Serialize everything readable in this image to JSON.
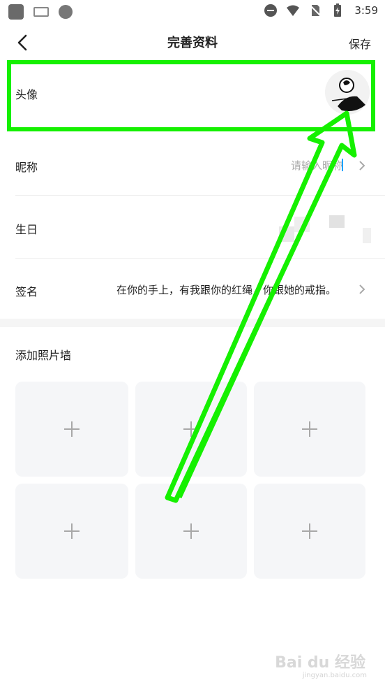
{
  "status_bar": {
    "time": "3:59",
    "left_icons": [
      "app-square-icon",
      "keyboard-icon",
      "sync-icon"
    ],
    "right_icons": [
      "do-not-disturb-icon",
      "wifi-icon",
      "no-sim-icon",
      "battery-charging-icon"
    ]
  },
  "header": {
    "title": "完善资料",
    "save_label": "保存"
  },
  "profile": {
    "avatar_label": "头像",
    "nickname_label": "昵称",
    "nickname_placeholder": "请输入昵称",
    "birthday_label": "生日",
    "signature_label": "签名",
    "signature_value": "在你的手上，有我跟你的红绳，你跟她的戒指。"
  },
  "photo_wall": {
    "title": "添加照片墙",
    "tile_count": 6
  },
  "annotation": {
    "highlight_color": "#15f000"
  },
  "watermark": {
    "text": "Bai du 经验",
    "sub": "jingyan.baidu.com"
  }
}
